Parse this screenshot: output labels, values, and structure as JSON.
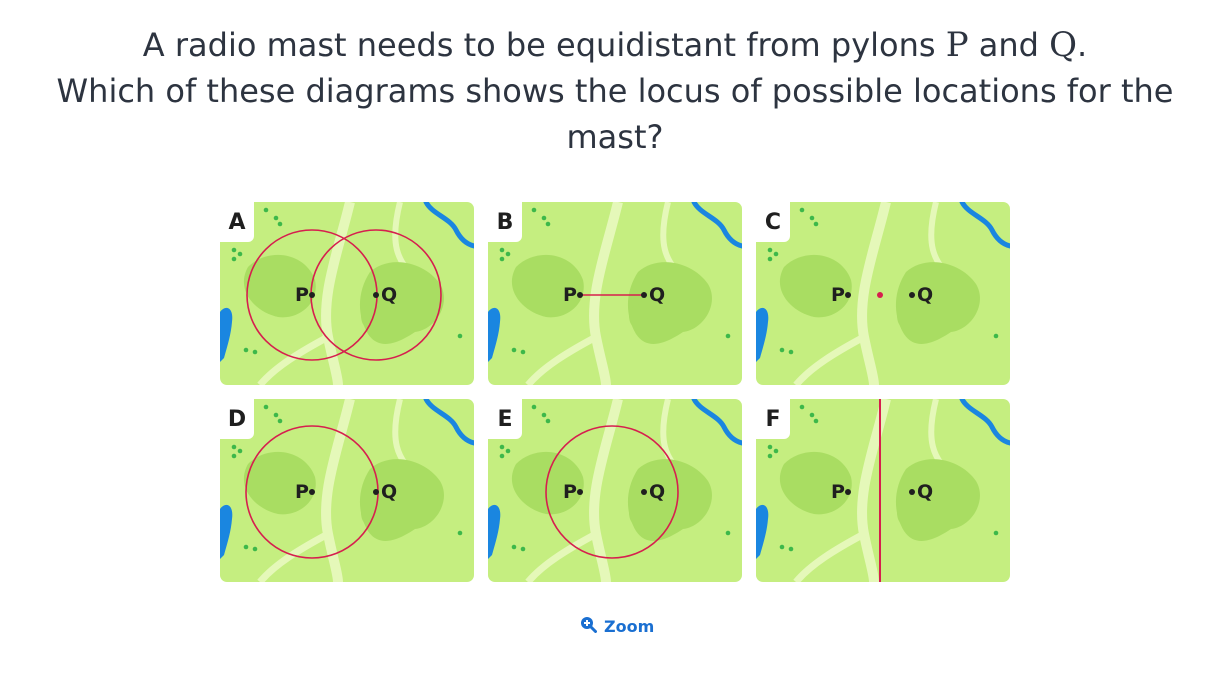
{
  "question": {
    "line1_before": "A radio mast needs to be equidistant from pylons ",
    "var_p": "P",
    "line1_and": " and ",
    "var_q": "Q",
    "line1_end": ".",
    "line2": "Which of these diagrams shows the locus of possible locations for the",
    "line3": "mast?"
  },
  "colors": {
    "map_green": "#c5ee80",
    "map_dark_green": "#a9dd62",
    "river_blue": "#1a86e0",
    "locus_red": "#d61f4e",
    "path_light": "#e5f8b9",
    "link_blue": "#1a6fd1"
  },
  "options": [
    {
      "letter": "A",
      "p_label": "P",
      "q_label": "Q",
      "locus": "two intersecting circles centred at P and Q"
    },
    {
      "letter": "B",
      "p_label": "P",
      "q_label": "Q",
      "locus": "line segment PQ"
    },
    {
      "letter": "C",
      "p_label": "P",
      "q_label": "Q",
      "locus": "midpoint of PQ"
    },
    {
      "letter": "D",
      "p_label": "P",
      "q_label": "Q",
      "locus": "circle centred at P through Q"
    },
    {
      "letter": "E",
      "p_label": "P",
      "q_label": "Q",
      "locus": "circle with diameter PQ"
    },
    {
      "letter": "F",
      "p_label": "P",
      "q_label": "Q",
      "locus": "perpendicular bisector of PQ"
    }
  ],
  "zoom": {
    "label": "Zoom",
    "icon": "zoom-in-icon"
  }
}
